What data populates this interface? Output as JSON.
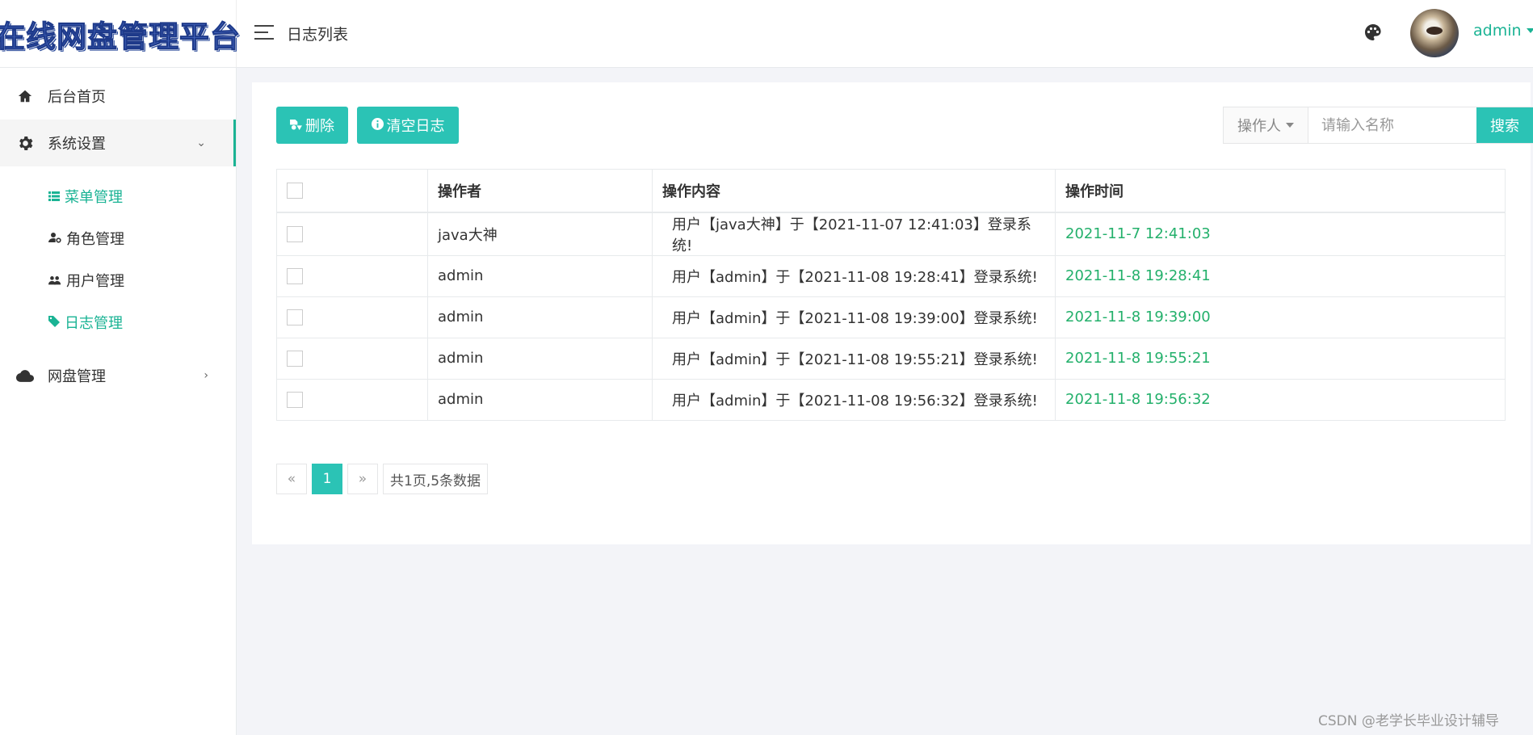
{
  "app": {
    "logo_text": "在线网盘管理平台",
    "page_title": "日志列表",
    "user_name": "admin"
  },
  "sidebar": {
    "items": [
      {
        "label": "后台首页",
        "icon": "home-icon"
      },
      {
        "label": "系统设置",
        "icon": "gear-icon",
        "expanded": true
      },
      {
        "label": "网盘管理",
        "icon": "cloud-icon",
        "expanded": false
      }
    ],
    "sub_items": [
      {
        "label": "菜单管理",
        "icon": "list-icon",
        "highlighted": true
      },
      {
        "label": "角色管理",
        "icon": "user-gear-icon",
        "highlighted": false
      },
      {
        "label": "用户管理",
        "icon": "users-icon",
        "highlighted": false
      },
      {
        "label": "日志管理",
        "icon": "tag-icon",
        "highlighted": true
      }
    ]
  },
  "toolbar": {
    "delete_label": "删除",
    "clear_label": "清空日志",
    "search_field_label": "操作人",
    "search_placeholder": "请输入名称",
    "search_label": "搜索"
  },
  "table": {
    "headers": [
      "操作者",
      "操作内容",
      "操作时间"
    ],
    "rows": [
      {
        "operator": "java大神",
        "content": "用户【java大神】于【2021-11-07 12:41:03】登录系统!",
        "time": "2021-11-7 12:41:03"
      },
      {
        "operator": "admin",
        "content": "用户【admin】于【2021-11-08 19:28:41】登录系统!",
        "time": "2021-11-8 19:28:41"
      },
      {
        "operator": "admin",
        "content": "用户【admin】于【2021-11-08 19:39:00】登录系统!",
        "time": "2021-11-8 19:39:00"
      },
      {
        "operator": "admin",
        "content": "用户【admin】于【2021-11-08 19:55:21】登录系统!",
        "time": "2021-11-8 19:55:21"
      },
      {
        "operator": "admin",
        "content": "用户【admin】于【2021-11-08 19:56:32】登录系统!",
        "time": "2021-11-8 19:56:32"
      }
    ]
  },
  "pagination": {
    "prev": "«",
    "current": "1",
    "next": "»",
    "summary": "共1页,5条数据"
  },
  "watermark": "CSDN @老学长毕业设计辅导",
  "colors": {
    "accent": "#2bc3b5",
    "active_text": "#1ab394",
    "time_text": "#23b06b"
  }
}
